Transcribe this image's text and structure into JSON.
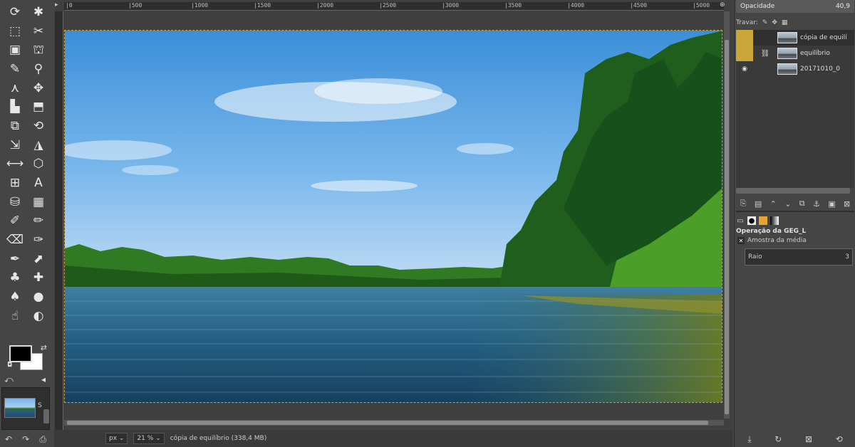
{
  "tools": [
    {
      "n": "free-select-icon",
      "g": "⟳"
    },
    {
      "n": "fuzzy-select-icon",
      "g": "✱"
    },
    {
      "n": "rect-select-icon",
      "g": "⬚"
    },
    {
      "n": "scissors-icon",
      "g": "✂"
    },
    {
      "n": "foreground-select-icon",
      "g": "▣"
    },
    {
      "n": "select-by-color-icon",
      "g": "⛫"
    },
    {
      "n": "color-picker-icon",
      "g": "✎"
    },
    {
      "n": "zoom-icon",
      "g": "⚲"
    },
    {
      "n": "paths-icon",
      "g": "⋏"
    },
    {
      "n": "move-icon",
      "g": "✥"
    },
    {
      "n": "align-icon",
      "g": "▙"
    },
    {
      "n": "crop-icon",
      "g": "⬒"
    },
    {
      "n": "unified-transform-icon",
      "g": "⧉"
    },
    {
      "n": "rotate-icon",
      "g": "⟲"
    },
    {
      "n": "scale-icon",
      "g": "⇲"
    },
    {
      "n": "shear-icon",
      "g": "◮"
    },
    {
      "n": "flip-icon",
      "g": "⟷"
    },
    {
      "n": "perspective-icon",
      "g": "⬡"
    },
    {
      "n": "cage-icon",
      "g": "⊞"
    },
    {
      "n": "text-icon",
      "g": "A"
    },
    {
      "n": "bucket-fill-icon",
      "g": "⛁"
    },
    {
      "n": "gradient-icon",
      "g": "▦"
    },
    {
      "n": "paintbrush-icon",
      "g": "✐"
    },
    {
      "n": "pencil-icon",
      "g": "✏"
    },
    {
      "n": "eraser-icon",
      "g": "⌫"
    },
    {
      "n": "airbrush-icon",
      "g": "✑"
    },
    {
      "n": "ink-icon",
      "g": "✒"
    },
    {
      "n": "mypaint-brush-icon",
      "g": "⬈"
    },
    {
      "n": "clone-icon",
      "g": "♣"
    },
    {
      "n": "heal-icon",
      "g": "✚"
    },
    {
      "n": "perspective-clone-icon",
      "g": "♠"
    },
    {
      "n": "blur-icon",
      "g": "●"
    },
    {
      "n": "smudge-icon",
      "g": "☝"
    },
    {
      "n": "dodge-burn-icon",
      "g": "◐"
    }
  ],
  "ruler": {
    "labels": [
      "|0",
      "|500",
      "|1000",
      "|1500",
      "|2000",
      "|2500",
      "|3000",
      "|3500",
      "|4000",
      "|4500",
      "|5000"
    ]
  },
  "canvas": {
    "image_alt": "Lake landscape with pine forest"
  },
  "status": {
    "unit": "px",
    "zoom": "21 %",
    "info": "cópia de equilíbrio (338,4 MB)"
  },
  "dock": {
    "opacity_label": "Opacidade",
    "opacity_value": "40,9",
    "lock_label": "Travar:",
    "layers": [
      {
        "name": "cópia de equilí",
        "active": true,
        "highlight": true,
        "chain": false
      },
      {
        "name": "equilíbrio",
        "active": false,
        "highlight": true,
        "chain": true
      },
      {
        "name": "20171010_0",
        "active": false,
        "highlight": false,
        "chain": false
      }
    ],
    "operation_label": "Operação da GEG_L",
    "sample_label": "Amostra da média",
    "radius_label": "Raio",
    "radius_value": "3"
  },
  "image_tab": {
    "label": "S"
  }
}
